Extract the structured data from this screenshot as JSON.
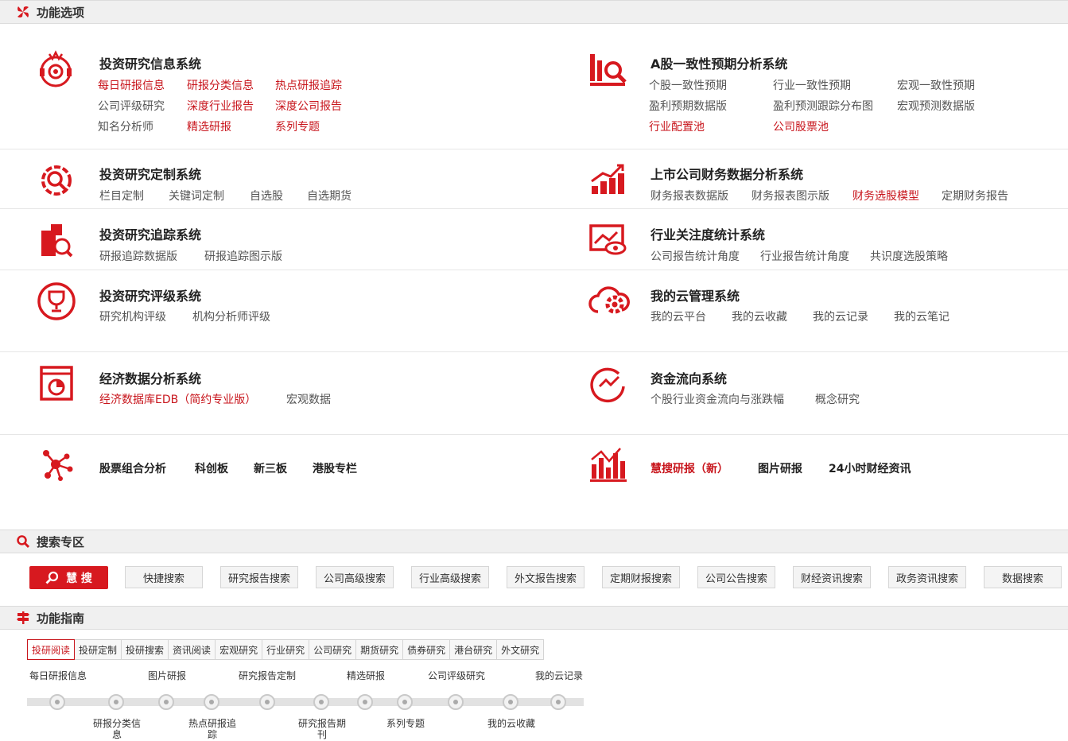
{
  "colors": {
    "accent": "#c8161d",
    "bar_bg": "#f0f0f0"
  },
  "sections": {
    "features": {
      "title": "功能选项",
      "icon": "pinwheel-icon"
    },
    "search": {
      "title": "搜索专区",
      "icon": "search-icon"
    },
    "guide": {
      "title": "功能指南",
      "icon": "signpost-icon"
    }
  },
  "systems": {
    "invest_info": {
      "title": "投资研究信息系统",
      "icon": "alarm-icon",
      "links": [
        "每日研报信息",
        "研报分类信息",
        "热点研报追踪",
        "公司评级研究",
        "深度行业报告",
        "深度公司报告",
        "知名分析师",
        "精选研报",
        "系列专题"
      ]
    },
    "consensus": {
      "title": "A股一致性预期分析系统",
      "icon": "analysis-chart-icon",
      "links": [
        "个股一致性预期",
        "行业一致性预期",
        "宏观一致性预期",
        "盈利预期数据版",
        "盈利预测跟踪分布图",
        "宏观预测数据版",
        "行业配置池",
        "公司股票池"
      ]
    },
    "custom": {
      "title": "投资研究定制系统",
      "icon": "gear-search-icon",
      "links": [
        "栏目定制",
        "关键词定制",
        "自选股",
        "自选期货"
      ]
    },
    "financial": {
      "title": "上市公司财务数据分析系统",
      "icon": "growth-chart-icon",
      "links": [
        "财务报表数据版",
        "财务报表图示版",
        "财务选股模型",
        "定期财务报告"
      ]
    },
    "tracking": {
      "title": "投资研究追踪系统",
      "icon": "building-search-icon",
      "links": [
        "研报追踪数据版",
        "研报追踪图示版"
      ]
    },
    "attention": {
      "title": "行业关注度统计系统",
      "icon": "monitor-eye-icon",
      "links": [
        "公司报告统计角度",
        "行业报告统计角度",
        "共识度选股策略"
      ]
    },
    "rating": {
      "title": "投资研究评级系统",
      "icon": "trophy-icon",
      "links": [
        "研究机构评级",
        "机构分析师评级"
      ]
    },
    "cloud": {
      "title": "我的云管理系统",
      "icon": "cloud-gear-icon",
      "links": [
        "我的云平台",
        "我的云收藏",
        "我的云记录",
        "我的云笔记"
      ]
    },
    "economic": {
      "title": "经济数据分析系统",
      "icon": "pie-report-icon",
      "links": [
        "经济数据库EDB（简约专业版）",
        "宏观数据"
      ]
    },
    "capital": {
      "title": "资金流向系统",
      "icon": "line-circle-icon",
      "links": [
        "个股行业资金流向与涨跌幅",
        "概念研究"
      ]
    }
  },
  "extra_left": {
    "icon": "network-icon",
    "links": [
      "股票组合分析",
      "科创板",
      "新三板",
      "港股专栏"
    ]
  },
  "extra_right": {
    "icon": "bar-trend-icon",
    "links": [
      "慧搜研报（新）",
      "图片研报",
      "24小时财经资讯"
    ]
  },
  "search": {
    "main_label": "慧 搜",
    "buttons": [
      "快捷搜索",
      "研究报告搜索",
      "公司高级搜索",
      "行业高级搜索",
      "外文报告搜索",
      "定期财报搜索",
      "公司公告搜索",
      "财经资讯搜索",
      "政务资讯搜索",
      "数据搜索"
    ]
  },
  "guide": {
    "tabs": [
      "投研阅读",
      "投研定制",
      "投研搜索",
      "资讯阅读",
      "宏观研究",
      "行业研究",
      "公司研究",
      "期货研究",
      "债券研究",
      "港台研究",
      "外文研究"
    ],
    "timeline_top": [
      "每日研报信息",
      "图片研报",
      "研究报告定制",
      "精选研报",
      "公司评级研究",
      "我的云记录"
    ],
    "timeline_bottom": [
      "研报分类信息",
      "热点研报追踪",
      "研究报告期刊",
      "系列专题",
      "我的云收藏"
    ]
  }
}
